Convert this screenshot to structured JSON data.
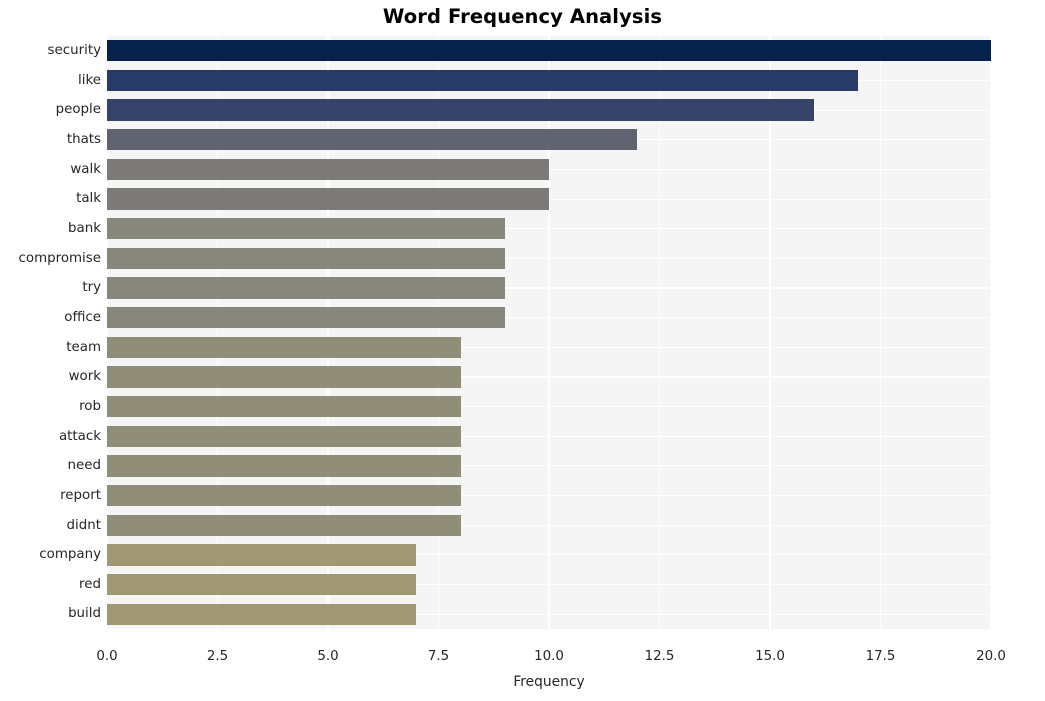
{
  "chart_data": {
    "type": "bar",
    "orientation": "horizontal",
    "title": "Word Frequency Analysis",
    "xlabel": "Frequency",
    "ylabel": "",
    "categories": [
      "security",
      "like",
      "people",
      "thats",
      "walk",
      "talk",
      "bank",
      "compromise",
      "try",
      "office",
      "team",
      "work",
      "rob",
      "attack",
      "need",
      "report",
      "didnt",
      "company",
      "red",
      "build"
    ],
    "values": [
      20,
      17,
      16,
      12,
      10,
      10,
      9,
      9,
      9,
      9,
      8,
      8,
      8,
      8,
      8,
      8,
      8,
      7,
      7,
      7
    ],
    "bar_colors": [
      "#06214c",
      "#273a68",
      "#364karten",
      "#606370",
      "#7c7b78",
      "#7c7b78",
      "#88877c",
      "#88877c",
      "#88877c",
      "#88877c",
      "#908e79",
      "#908e79",
      "#908e79",
      "#908e79",
      "#908e79",
      "#908e79",
      "#908e79",
      "#a09872",
      "#a09872",
      "#a09872"
    ],
    "xlim": [
      0,
      20
    ],
    "xticks": [
      0,
      2.5,
      5,
      7.5,
      10,
      12.5,
      15,
      17.5,
      20
    ],
    "xticklabels": [
      "0.0",
      "2.5",
      "5.0",
      "7.5",
      "10.0",
      "12.5",
      "15.0",
      "17.5",
      "20.0"
    ],
    "grid": true,
    "grid_axis": "both",
    "legend": null,
    "style": {
      "plot_background": "#f5f5f5",
      "figure_background": "#ffffff",
      "gridline_color": "#ffffff",
      "text_color": "#262626"
    }
  }
}
